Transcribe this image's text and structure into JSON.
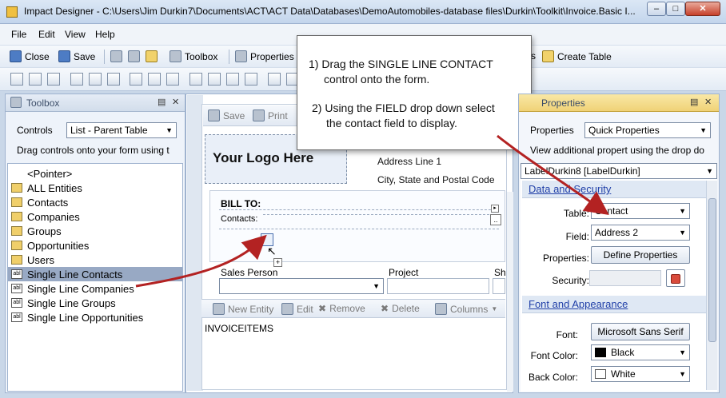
{
  "window": {
    "title": "Impact Designer - C:\\Users\\Jim Durkin7\\Documents\\ACT\\ACT Data\\Databases\\DemoAutomobiles-database files\\Durkin\\Toolkit\\Invoice.Basic I..."
  },
  "menu": [
    "File",
    "Edit",
    "View",
    "Help"
  ],
  "toolbar": {
    "close": "Close",
    "save": "Save",
    "toolbox": "Toolbox",
    "properties": "Properties",
    "hidden_s": "s",
    "create_table": "Create Table"
  },
  "toolbox": {
    "title": "Toolbox",
    "controls_label": "Controls",
    "controls_value": "List - Parent Table",
    "hint": "Drag controls onto your form using t",
    "items": [
      "<Pointer>",
      "ALL Entities",
      "Contacts",
      "Companies",
      "Groups",
      "Opportunities",
      "Users",
      "Single Line Contacts",
      "Single Line Companies",
      "Single Line Groups",
      "Single Line Opportunities"
    ]
  },
  "designer": {
    "save": "Save",
    "print": "Print",
    "logo": "Your Logo Here",
    "address1": "Address Line 1",
    "address2": "City, State and Postal Code",
    "bill_to": "BILL TO:",
    "contacts_label": "Contacts:",
    "sales_person": "Sales Person",
    "project": "Project",
    "sh": "Sh",
    "new_entity": "New Entity",
    "edit": "Edit",
    "remove": "Remove",
    "delete": "Delete",
    "columns": "Columns",
    "invoice_items": "INVOICEITEMS"
  },
  "callout": {
    "line1a": "1) Drag the SINGLE LINE CONTACT",
    "line1b": "control onto the form.",
    "line2a": "2) Using the FIELD drop down select",
    "line2b": "the contact field to display."
  },
  "properties": {
    "title": "Properties",
    "label": "Properties",
    "mode": "Quick Properties",
    "hint": "View additional propert using the drop do",
    "object": "LabelDurkin8 [LabelDurkin]",
    "section1": "Data and Security",
    "table_label": "Table:",
    "table_value": "Contact",
    "field_label": "Field:",
    "field_value": "Address 2",
    "props_label": "Properties:",
    "define_button": "Define Properties",
    "security_label": "Security:",
    "section2": "Font and Appearance",
    "font_label": "Font:",
    "font_value": "Microsoft Sans Serif",
    "fontcolor_label": "Font Color:",
    "fontcolor_value": "Black",
    "backcolor_label": "Back Color:",
    "backcolor_value": "White"
  },
  "colors": {
    "arrow": "#b32222",
    "selection": "#98a9c4",
    "link": "#2140a8"
  }
}
